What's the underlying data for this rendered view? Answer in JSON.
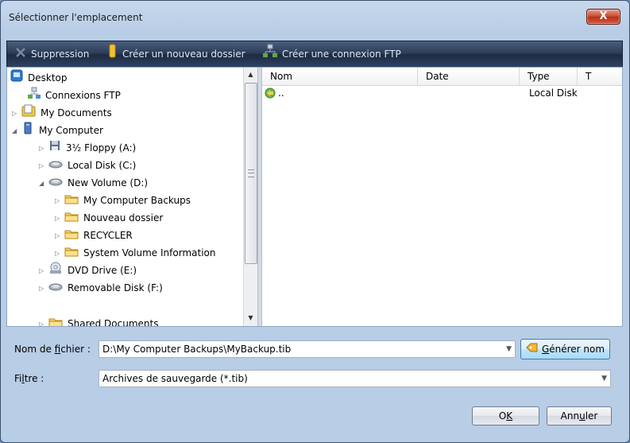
{
  "window": {
    "title": "Sélectionner l'emplacement",
    "close_label": "X"
  },
  "toolbar": {
    "delete_label": "Suppression",
    "new_folder_label": "Créer un nouveau dossier",
    "ftp_label": "Créer une connexion FTP"
  },
  "tree": {
    "items": [
      {
        "label": "Desktop",
        "icon": "desktop-icon"
      },
      {
        "label": "Connexions FTP",
        "icon": "network-icon"
      },
      {
        "label": "My Documents",
        "icon": "documents-folder-icon"
      },
      {
        "label": "My Computer",
        "icon": "computer-icon"
      },
      {
        "label": "3½ Floppy (A:)",
        "icon": "floppy-icon"
      },
      {
        "label": "Local Disk (C:)",
        "icon": "harddisk-icon"
      },
      {
        "label": "New Volume (D:)",
        "icon": "harddisk-icon"
      },
      {
        "label": "My Computer Backups",
        "icon": "folder-icon"
      },
      {
        "label": "Nouveau dossier",
        "icon": "folder-icon"
      },
      {
        "label": "RECYCLER",
        "icon": "folder-icon"
      },
      {
        "label": "System Volume Information",
        "icon": "folder-icon"
      },
      {
        "label": "DVD Drive (E:)",
        "icon": "dvd-icon"
      },
      {
        "label": "Removable Disk (F:)",
        "icon": "removable-disk-icon"
      },
      {
        "label": "Shared Documents",
        "icon": "folder-icon"
      }
    ]
  },
  "list": {
    "columns": [
      "Nom",
      "Date",
      "Type",
      "T"
    ],
    "rows": [
      {
        "name": "..",
        "date": "",
        "type": "Local Disk"
      }
    ]
  },
  "filename": {
    "label_pre": "Nom de ",
    "label_ul": "f",
    "label_post": "ichier :",
    "value": "D:\\My Computer Backups\\MyBackup.tib",
    "generate_pre": "",
    "generate_ul": "G",
    "generate_post": "énérer nom"
  },
  "filter": {
    "label_pre": "Fi",
    "label_ul": "l",
    "label_post": "tre :",
    "value": "Archives de sauvegarde (*.tib)"
  },
  "buttons": {
    "ok_pre": "O",
    "ok_ul": "K",
    "cancel_pre": "Ann",
    "cancel_ul": "u",
    "cancel_post": "ler"
  },
  "colors": {
    "toolbar_bg": "#2b3b55",
    "window_bg": "#b8cde6",
    "close_red": "#c7442c"
  }
}
